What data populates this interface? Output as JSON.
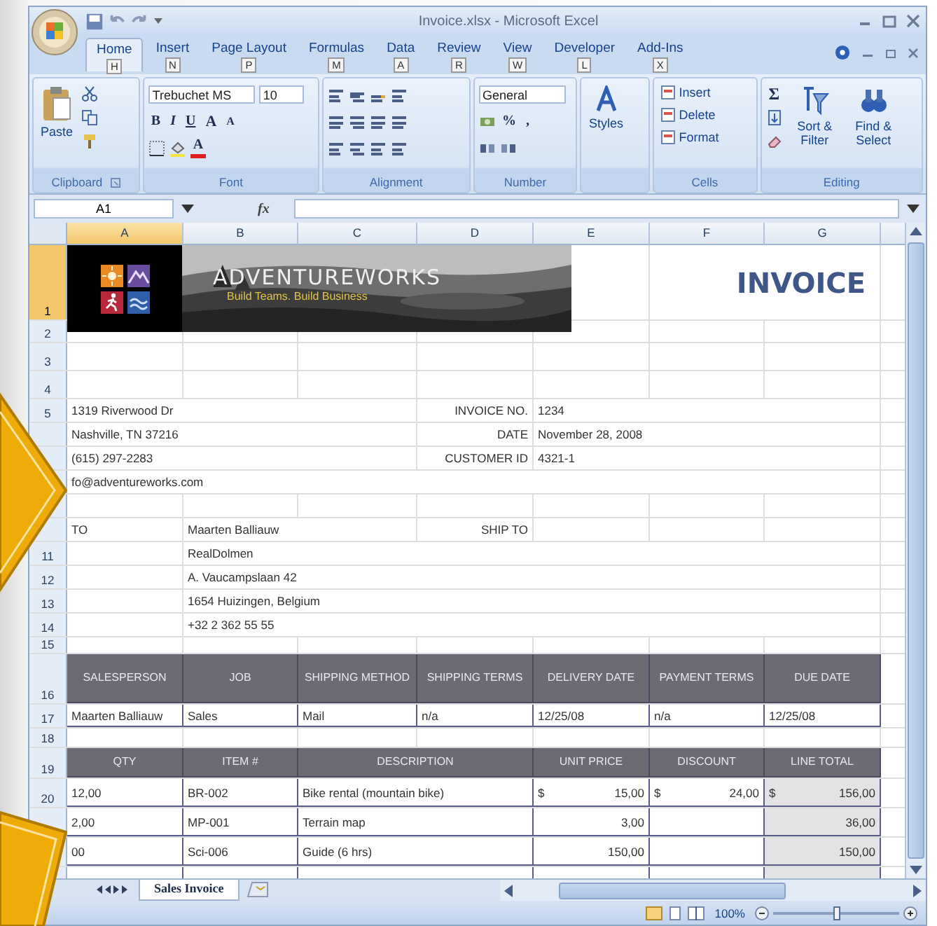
{
  "window": {
    "title": "Invoice.xlsx - Microsoft Excel"
  },
  "ribbon": {
    "tabs": [
      {
        "label": "Home",
        "keytip": "H",
        "selected": true
      },
      {
        "label": "Insert",
        "keytip": "N",
        "selected": false
      },
      {
        "label": "Page Layout",
        "keytip": "P",
        "selected": false
      },
      {
        "label": "Formulas",
        "keytip": "M",
        "selected": false
      },
      {
        "label": "Data",
        "keytip": "A",
        "selected": false
      },
      {
        "label": "Review",
        "keytip": "R",
        "selected": false
      },
      {
        "label": "View",
        "keytip": "W",
        "selected": false
      },
      {
        "label": "Developer",
        "keytip": "L",
        "selected": false
      },
      {
        "label": "Add-Ins",
        "keytip": "X",
        "selected": false
      }
    ],
    "paste": "Paste",
    "font_name": "Trebuchet MS",
    "font_size": "10",
    "font_styles": [
      "B",
      "I",
      "U"
    ],
    "grow_shrink": [
      "A",
      "A"
    ],
    "font_color": "A",
    "number_format": "General",
    "number_symbols": [
      "%",
      ","
    ],
    "styles": "Styles",
    "cells_buttons": [
      "Insert",
      "Delete",
      "Format"
    ],
    "sum": "Σ",
    "editing_buttons": [
      "Sort & Filter",
      "Find & Select"
    ],
    "group_labels": [
      "Clipboard",
      "Font",
      "Alignment",
      "Number",
      "Cells",
      "Editing"
    ]
  },
  "formula_bar": {
    "name_box": "A1",
    "fx": "fx"
  },
  "sheet": {
    "columns": [
      {
        "label": "A",
        "selected": true
      },
      {
        "label": "B",
        "selected": false
      },
      {
        "label": "C",
        "selected": false
      },
      {
        "label": "D",
        "selected": false
      },
      {
        "label": "E",
        "selected": false
      },
      {
        "label": "F",
        "selected": false
      },
      {
        "label": "G",
        "selected": false
      }
    ],
    "rows": [
      {
        "number": "1",
        "selected": true,
        "kind": "plain",
        "cells": {
          "A": {
            "kind": "logo",
            "name": "ADVENTUREWORKS",
            "tagline": "Build Teams. Build Business"
          },
          "F": {
            "kind": "title",
            "text": "INVOICE"
          }
        }
      },
      {
        "number": "2",
        "selected": false,
        "kind": "plain"
      },
      {
        "number": "3",
        "selected": false,
        "kind": "plain"
      },
      {
        "number": "4",
        "selected": false,
        "kind": "plain"
      },
      {
        "number": "5",
        "selected": false,
        "kind": "plain",
        "cells": {
          "A": {
            "kind": "text",
            "text": "1319 Riverwood Dr"
          },
          "D": {
            "kind": "label",
            "text": "INVOICE NO."
          },
          "E": {
            "kind": "text",
            "text": "1234"
          }
        }
      },
      {
        "kind": "plain",
        "cells": {
          "A": {
            "kind": "text",
            "text": "Nashville, TN 37216"
          },
          "D": {
            "kind": "label",
            "text": "DATE"
          },
          "E": {
            "kind": "text",
            "text": "November 28, 2008"
          }
        }
      },
      {
        "kind": "plain",
        "cells": {
          "A": {
            "kind": "text",
            "text": "(615) 297-2283"
          },
          "D": {
            "kind": "label",
            "text": "CUSTOMER ID"
          },
          "E": {
            "kind": "text",
            "text": "4321-1"
          }
        }
      },
      {
        "kind": "plain",
        "cells": {
          "A": {
            "kind": "text",
            "text": "fo@adventureworks.com"
          }
        }
      },
      {
        "kind": "plain"
      },
      {
        "kind": "plain",
        "cells": {
          "A": {
            "kind": "text",
            "text": "TO"
          },
          "B": {
            "kind": "text",
            "text": "Maarten Balliauw"
          },
          "D": {
            "kind": "label",
            "text": "SHIP TO"
          }
        }
      },
      {
        "number": "11",
        "selected": false,
        "kind": "plain",
        "cells": {
          "B": {
            "kind": "text",
            "text": "RealDolmen"
          }
        }
      },
      {
        "number": "12",
        "selected": false,
        "kind": "plain",
        "cells": {
          "B": {
            "kind": "text",
            "text": "A. Vaucampslaan 42"
          }
        }
      },
      {
        "number": "13",
        "selected": false,
        "kind": "plain",
        "cells": {
          "B": {
            "kind": "text",
            "text": "1654 Huizingen, Belgium"
          }
        }
      },
      {
        "number": "14",
        "selected": false,
        "kind": "plain",
        "cells": {
          "B": {
            "kind": "text",
            "text": "+32 2 362 55 55"
          }
        }
      },
      {
        "number": "15",
        "selected": false,
        "kind": "plain"
      },
      {
        "number": "16",
        "selected": false,
        "kind": "orders",
        "cells": [
          {
            "kind": "header",
            "text": "SALESPERSON"
          },
          {
            "kind": "header",
            "text": "JOB"
          },
          {
            "kind": "header",
            "text": "SHIPPING METHOD"
          },
          {
            "kind": "header",
            "text": "SHIPPING TERMS"
          },
          {
            "kind": "header",
            "text": "DELIVERY DATE"
          },
          {
            "kind": "header",
            "text": "PAYMENT TERMS"
          },
          {
            "kind": "header",
            "text": "DUE DATE"
          }
        ]
      },
      {
        "number": "17",
        "selected": false,
        "kind": "orders",
        "cells": [
          {
            "kind": "text",
            "text": "Maarten Balliauw"
          },
          {
            "kind": "text",
            "text": "Sales"
          },
          {
            "kind": "text",
            "text": "Mail"
          },
          {
            "kind": "text",
            "text": "n/a"
          },
          {
            "kind": "text",
            "text": "12/25/08"
          },
          {
            "kind": "text",
            "text": "n/a"
          },
          {
            "kind": "text",
            "text": "12/25/08"
          }
        ]
      },
      {
        "number": "18",
        "selected": false,
        "kind": "plain"
      },
      {
        "number": "19",
        "selected": false,
        "kind": "items",
        "cells": [
          {
            "kind": "header",
            "text": "QTY"
          },
          {
            "kind": "header",
            "text": "ITEM #"
          },
          {
            "kind": "header",
            "text": "DESCRIPTION"
          },
          {
            "kind": "header",
            "text": "UNIT PRICE"
          },
          {
            "kind": "header",
            "text": "DISCOUNT"
          },
          {
            "kind": "header",
            "text": "LINE TOTAL"
          }
        ]
      },
      {
        "number": "20",
        "selected": false,
        "kind": "items",
        "cells": [
          {
            "kind": "text",
            "text": "12,00"
          },
          {
            "kind": "text",
            "text": "BR-002"
          },
          {
            "kind": "text",
            "text": "Bike rental (mountain bike)"
          },
          {
            "kind": "money",
            "currency": "$",
            "text": "15,00"
          },
          {
            "kind": "money",
            "currency": "$",
            "text": "24,00"
          },
          {
            "kind": "total",
            "currency": "$",
            "text": "156,00"
          }
        ]
      },
      {
        "kind": "items",
        "cells": [
          {
            "kind": "text",
            "text": "2,00"
          },
          {
            "kind": "text",
            "text": "MP-001"
          },
          {
            "kind": "text",
            "text": "Terrain map"
          },
          {
            "kind": "money",
            "text": "3,00"
          },
          {
            "kind": "money"
          },
          {
            "kind": "total",
            "text": "36,00"
          }
        ]
      },
      {
        "kind": "items",
        "cells": [
          {
            "kind": "text",
            "text": "00"
          },
          {
            "kind": "text",
            "text": "Sci-006"
          },
          {
            "kind": "text",
            "text": "Guide (6 hrs)"
          },
          {
            "kind": "money",
            "text": "150,00"
          },
          {
            "kind": "money"
          },
          {
            "kind": "total",
            "text": "150,00"
          }
        ]
      },
      {
        "kind": "items",
        "cells": [
          {
            "kind": "text"
          },
          {
            "kind": "text"
          },
          {
            "kind": "text"
          },
          {
            "kind": "money"
          },
          {
            "kind": "money"
          },
          {
            "kind": "total"
          }
        ]
      }
    ]
  },
  "sheet_tabs": [
    {
      "label": "Sales Invoice",
      "selected": true
    }
  ],
  "status_bar": {
    "zoom": "100%",
    "level": 0.5
  }
}
